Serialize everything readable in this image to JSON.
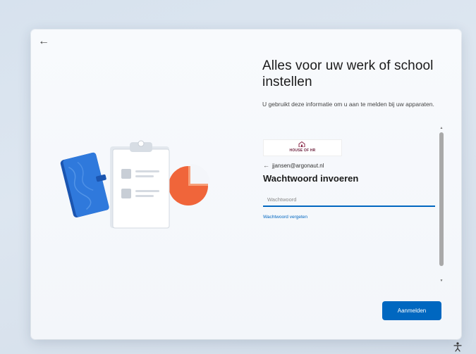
{
  "window": {
    "back_icon": "arrow-left-icon"
  },
  "header": {
    "title": "Alles voor uw werk of school instellen",
    "subtitle": "U gebruikt deze informatie om u aan te melden bij uw apparaten."
  },
  "signin_frame": {
    "logo_text": "HOUSE OF HR",
    "account_email": "jjansen@argonaut.nl",
    "heading": "Wachtwoord invoeren",
    "password_placeholder": "Wachtwoord",
    "password_value": "",
    "forgot_link": "Wachtwoord vergeten"
  },
  "footer": {
    "signin_label": "Aanmelden",
    "accessibility_icon": "accessibility-icon"
  },
  "colors": {
    "accent": "#0067c0",
    "logo": "#6b1d3a",
    "notebook": "#1e63c4",
    "pie": "#f0653a"
  }
}
